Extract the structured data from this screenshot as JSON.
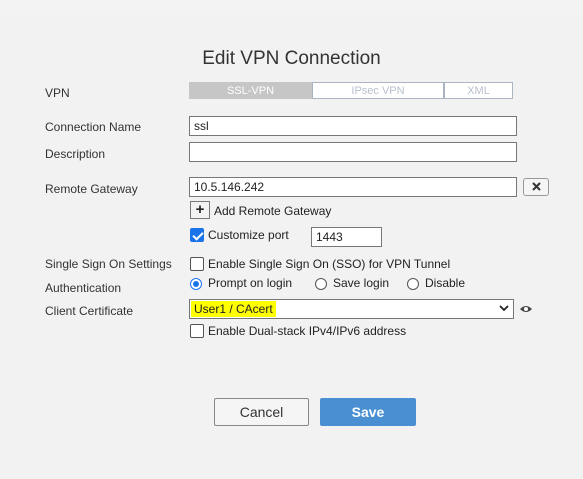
{
  "dialog": {
    "title": "Edit VPN Connection"
  },
  "labels": {
    "vpn": "VPN",
    "connection_name": "Connection Name",
    "description": "Description",
    "remote_gateway": "Remote Gateway",
    "sso_settings": "Single Sign On Settings",
    "authentication": "Authentication",
    "client_certificate": "Client Certificate"
  },
  "vpn_types": [
    {
      "label": "SSL-VPN",
      "active": true
    },
    {
      "label": "IPsec VPN",
      "active": false
    },
    {
      "label": "XML",
      "active": false
    }
  ],
  "fields": {
    "connection_name": "ssl",
    "description": "",
    "remote_gateway": "10.5.146.242",
    "port": "1443"
  },
  "remote_gateway": {
    "add_label": "Add Remote Gateway",
    "remove_icon": "close-icon"
  },
  "customize_port": {
    "label": "Customize port",
    "checked": true
  },
  "sso": {
    "label": "Enable Single Sign On (SSO) for VPN Tunnel",
    "checked": false
  },
  "authentication": {
    "options": [
      "Prompt on login",
      "Save login",
      "Disable"
    ],
    "selected": "Prompt on login"
  },
  "client_certificate": {
    "selected": "User1 / CAcert"
  },
  "dual_stack": {
    "label": "Enable Dual-stack IPv4/IPv6 address",
    "checked": false
  },
  "buttons": {
    "cancel": "Cancel",
    "save": "Save"
  },
  "colors": {
    "primary": "#4a8fd1",
    "highlight": "#ffff00",
    "checkbox": "#1a73e8"
  }
}
